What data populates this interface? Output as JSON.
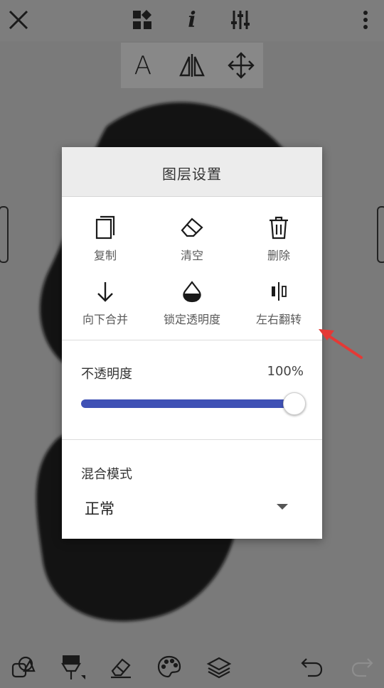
{
  "top_toolbar": {
    "icons": [
      "close-icon",
      "widgets-icon",
      "info-icon",
      "adjust-sliders-icon",
      "more-vertical-icon"
    ],
    "info_glyph": "i"
  },
  "sub_toolbar": {
    "text_glyph": "A",
    "icons": [
      "text-icon",
      "flip-icon",
      "move-icon"
    ]
  },
  "dialog": {
    "title": "图层设置",
    "actions": [
      {
        "label": "复制",
        "icon": "copy-icon"
      },
      {
        "label": "清空",
        "icon": "eraser-icon"
      },
      {
        "label": "删除",
        "icon": "trash-icon"
      },
      {
        "label": "向下合并",
        "icon": "arrow-down-icon"
      },
      {
        "label": "锁定透明度",
        "icon": "drop-icon"
      },
      {
        "label": "左右翻转",
        "icon": "flip-horizontal-icon"
      }
    ],
    "opacity": {
      "label": "不透明度",
      "value_text": "100%",
      "value": 1.0
    },
    "blend": {
      "label": "混合模式",
      "selected": "正常"
    }
  },
  "bottom_toolbar": {
    "icons": [
      "shapes-icon",
      "brush-icon",
      "eraser-icon",
      "palette-icon",
      "layers-icon",
      "undo-icon",
      "redo-icon"
    ]
  },
  "colors": {
    "accent": "#3f51b5",
    "annotation_arrow": "#e53935"
  }
}
